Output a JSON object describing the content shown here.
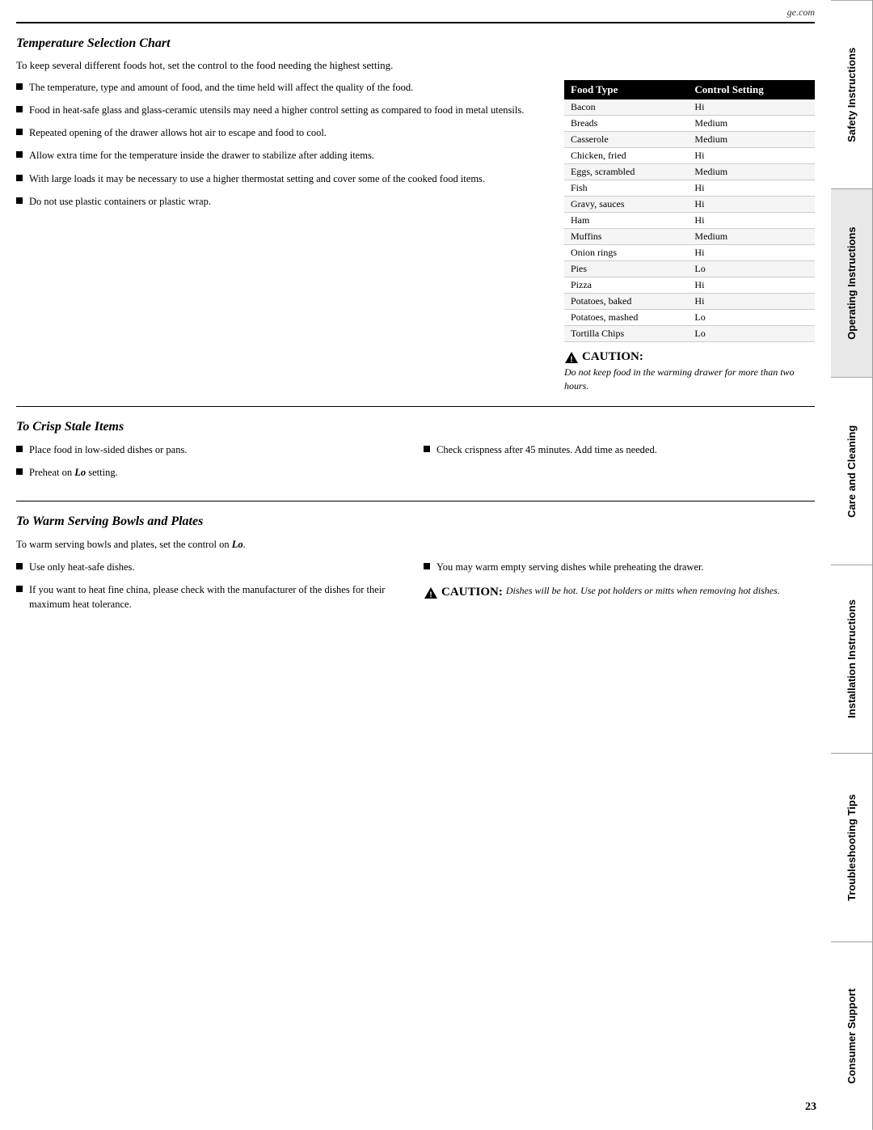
{
  "header": {
    "website": "ge.com"
  },
  "page_number": "23",
  "side_tabs": [
    {
      "id": "safety",
      "label": "Safety Instructions",
      "active": false
    },
    {
      "id": "operating",
      "label": "Operating Instructions",
      "active": true
    },
    {
      "id": "care",
      "label": "Care and Cleaning",
      "active": false
    },
    {
      "id": "installation",
      "label": "Installation Instructions",
      "active": false
    },
    {
      "id": "troubleshooting",
      "label": "Troubleshooting Tips",
      "active": false
    },
    {
      "id": "consumer",
      "label": "Consumer Support",
      "active": false
    }
  ],
  "temp_section": {
    "title": "Temperature Selection Chart",
    "subtitle": "To keep several different foods hot, set the control to the food needing the highest setting.",
    "bullets": [
      "The temperature, type and amount of food, and the time held will affect the quality of the food.",
      "Food in heat-safe glass and glass-ceramic utensils may need a higher control setting as compared to food in metal utensils.",
      "Repeated opening of the drawer allows hot air to escape and food to cool.",
      "Allow extra time for the temperature inside the drawer to stabilize after adding items.",
      "With large loads it may be necessary to use a higher thermostat setting and cover some of the cooked food items.",
      "Do not use plastic containers or plastic wrap."
    ],
    "table": {
      "col1_header": "Food Type",
      "col2_header": "Control Setting",
      "rows": [
        {
          "food": "Bacon",
          "setting": "Hi"
        },
        {
          "food": "Breads",
          "setting": "Medium"
        },
        {
          "food": "Casserole",
          "setting": "Medium"
        },
        {
          "food": "Chicken, fried",
          "setting": "Hi"
        },
        {
          "food": "Eggs, scrambled",
          "setting": "Medium"
        },
        {
          "food": "Fish",
          "setting": "Hi"
        },
        {
          "food": "Gravy, sauces",
          "setting": "Hi"
        },
        {
          "food": "Ham",
          "setting": "Hi"
        },
        {
          "food": "Muffins",
          "setting": "Medium"
        },
        {
          "food": "Onion rings",
          "setting": "Hi"
        },
        {
          "food": "Pies",
          "setting": "Lo"
        },
        {
          "food": "Pizza",
          "setting": "Hi"
        },
        {
          "food": "Potatoes, baked",
          "setting": "Hi"
        },
        {
          "food": "Potatoes, mashed",
          "setting": "Lo"
        },
        {
          "food": "Tortilla Chips",
          "setting": "Lo"
        }
      ]
    },
    "caution": {
      "label": "CAUTION:",
      "text": "Do not keep food in the warming drawer for more than two hours."
    }
  },
  "crisp_section": {
    "title": "To Crisp Stale Items",
    "left_bullets": [
      "Place food in low-sided dishes or pans.",
      "Preheat on Lo setting."
    ],
    "right_bullets": [
      "Check crispness after 45 minutes. Add time as needed."
    ],
    "lo_bold": "Lo"
  },
  "warm_section": {
    "title": "To Warm Serving Bowls and Plates",
    "intro": "To warm serving bowls and plates, set the control on",
    "intro_bold": "Lo",
    "intro_end": ".",
    "left_bullets": [
      "Use only heat-safe dishes.",
      "If you want to heat fine china, please check with the manufacturer of the dishes for their maximum heat tolerance."
    ],
    "right_bullets": [
      "You may warm empty serving dishes while preheating the drawer."
    ],
    "caution": {
      "label": "CAUTION:",
      "text": "Dishes will be hot. Use pot holders or mitts when removing hot dishes."
    }
  }
}
